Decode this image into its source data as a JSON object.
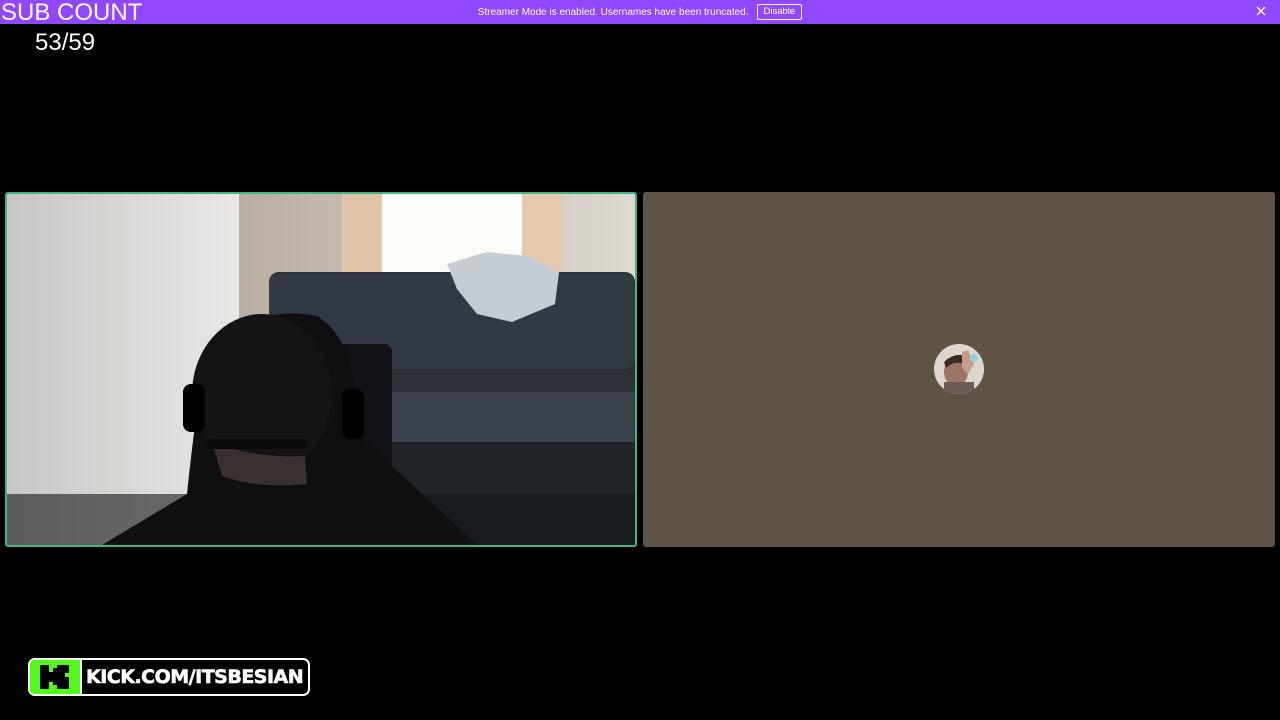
{
  "banner": {
    "message": "Streamer Mode is enabled. Usernames have been truncated.",
    "button_label": "Disable",
    "close_icon": "close-icon",
    "background_color": "#9147ff"
  },
  "overlay": {
    "title": "SUB COUNT",
    "count": "53/59"
  },
  "tiles": {
    "left": {
      "type": "video",
      "speaking_border_color": "#43b581"
    },
    "right": {
      "type": "avatar",
      "background_color": "#5f5346",
      "avatar_icon": "user-avatar"
    }
  },
  "kick_badge": {
    "logo": "kick-logo-icon",
    "text": "KICK.COM/ITSBESIAN",
    "logo_color": "#53fc18"
  }
}
